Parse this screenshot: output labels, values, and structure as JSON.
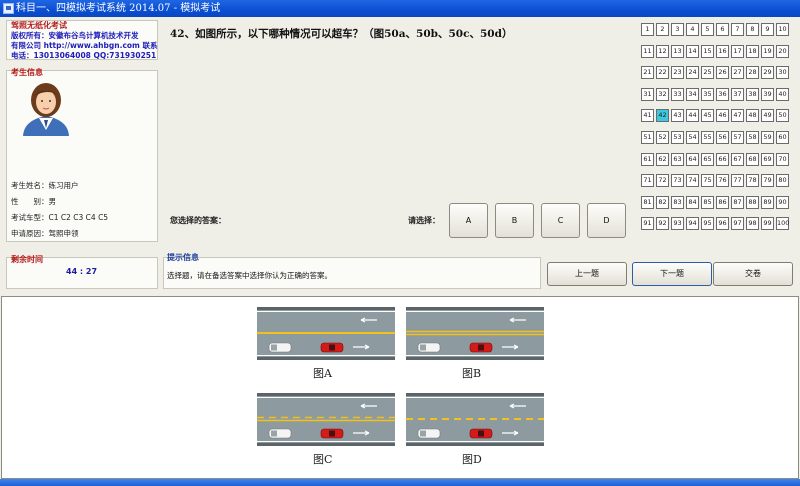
{
  "window": {
    "title": "科目一、四模拟考试系统 2014.07 - 模拟考试"
  },
  "copyright": {
    "label": "驾照无纸化考试",
    "line1": "版权所有：安徽布谷鸟计算机技术开发",
    "line2": "有限公司 http://www.ahbgn.com 联系",
    "line3": "电话：13013064008 QQ:731930251"
  },
  "examinee": {
    "label": "考生信息",
    "name_label": "考生姓名：",
    "name": "练习用户",
    "gender_label": "性　　别：",
    "gender": "男",
    "vehicle_label": "考试车型：",
    "vehicle": "C1 C2 C3 C4 C5",
    "reason_label": "申请原因：",
    "reason": "驾照申领"
  },
  "question": {
    "text": "42、如图所示，以下哪种情况可以超车？（图50a、50b、50c、50d）"
  },
  "answer": {
    "selected_label": "您选择的答案：",
    "selected_value": "",
    "choose_label": "请选择：",
    "options": [
      "A",
      "B",
      "C",
      "D"
    ]
  },
  "question_grid": {
    "numbers": [
      1,
      2,
      3,
      4,
      5,
      6,
      7,
      8,
      9,
      10,
      11,
      12,
      13,
      14,
      15,
      16,
      17,
      18,
      19,
      20,
      21,
      22,
      23,
      24,
      25,
      26,
      27,
      28,
      29,
      30,
      31,
      32,
      33,
      34,
      35,
      36,
      37,
      38,
      39,
      40,
      41,
      42,
      43,
      44,
      45,
      46,
      47,
      48,
      49,
      50,
      51,
      52,
      53,
      54,
      55,
      56,
      57,
      58,
      59,
      60,
      61,
      62,
      63,
      64,
      65,
      66,
      67,
      68,
      69,
      70,
      71,
      72,
      73,
      74,
      75,
      76,
      77,
      78,
      79,
      80,
      81,
      82,
      83,
      84,
      85,
      86,
      87,
      88,
      89,
      90,
      91,
      92,
      93,
      94,
      95,
      96,
      97,
      98,
      99,
      100
    ],
    "current": 42
  },
  "timer": {
    "label": "剩余时间",
    "value": "44 : 27"
  },
  "hint": {
    "label": "提示信息",
    "text": "选择题，请在备选答案中选择你认为正确的答案。"
  },
  "nav": {
    "prev": "上一题",
    "next": "下一题",
    "submit": "交卷"
  },
  "figures": [
    {
      "caption": "图A",
      "center": "solid"
    },
    {
      "caption": "图B",
      "center": "double"
    },
    {
      "caption": "图C",
      "center": "dashed-solid"
    },
    {
      "caption": "图D",
      "center": "dashed"
    }
  ],
  "colors": {
    "titlebar": "#0a4fd2",
    "section_label": "#b21a1a",
    "current_cell": "#39c9e0",
    "road": "#8d9aa0",
    "center_line": "#f2c21b"
  }
}
